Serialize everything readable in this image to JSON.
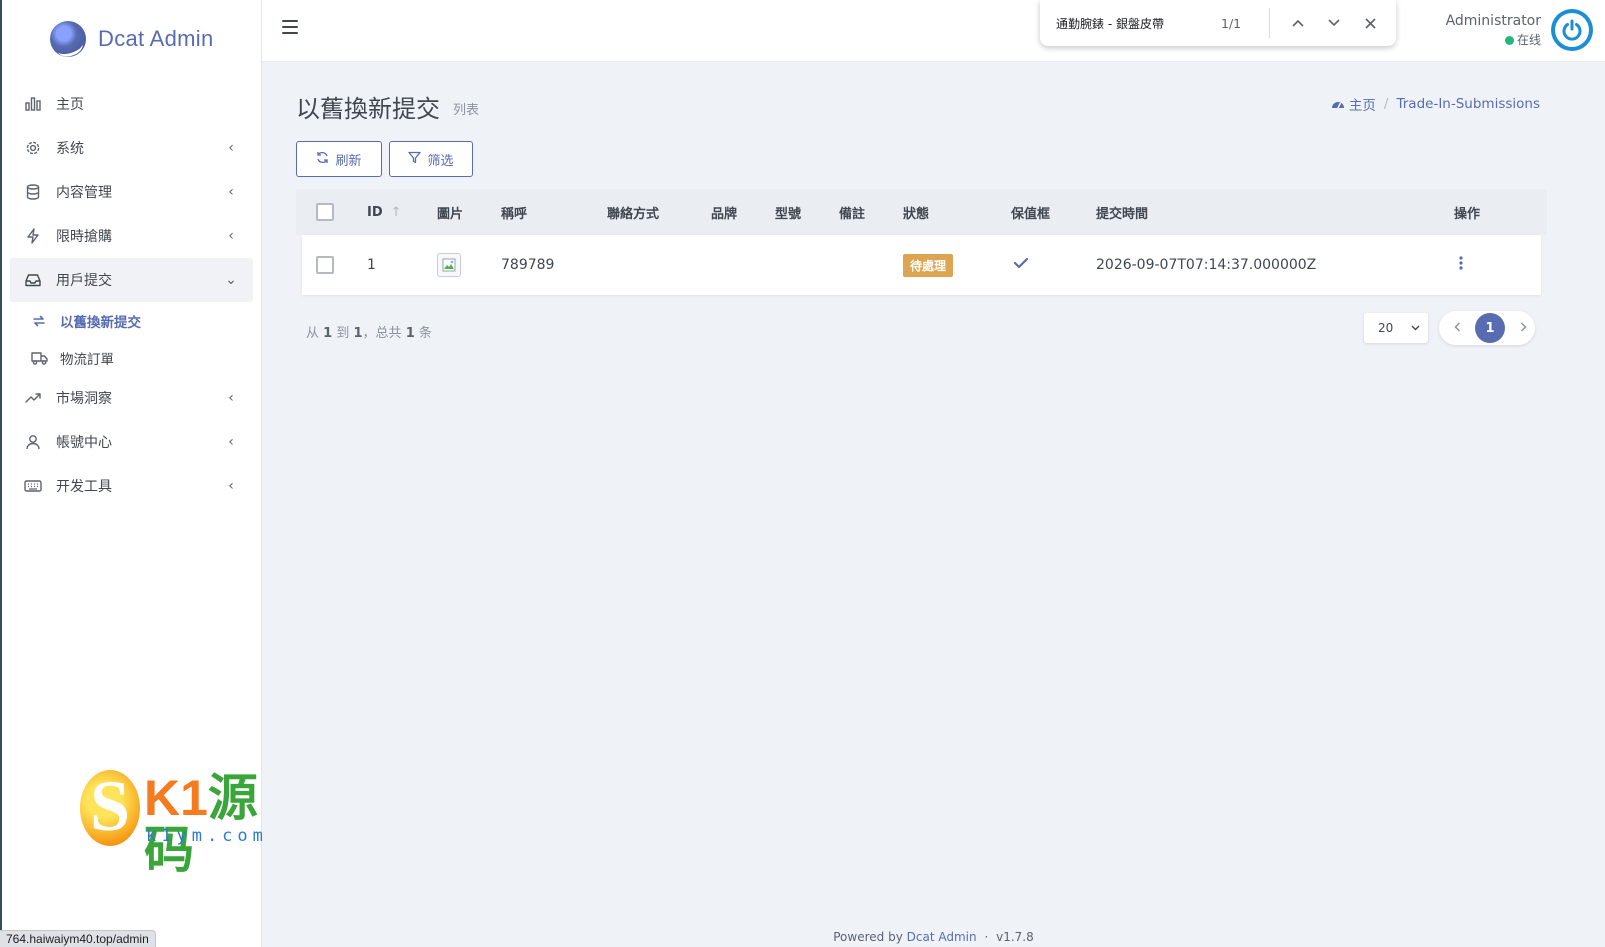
{
  "brand": {
    "name": "Dcat Admin"
  },
  "sidebar": {
    "items": [
      {
        "label": "主页",
        "icon": "bar-chart-icon",
        "arrow": ""
      },
      {
        "label": "系统",
        "icon": "gear-icon",
        "arrow": "‹"
      },
      {
        "label": "内容管理",
        "icon": "database-icon",
        "arrow": "‹"
      },
      {
        "label": "限時搶購",
        "icon": "lightning-icon",
        "arrow": "‹"
      },
      {
        "label": "用戶提交",
        "icon": "inbox-icon",
        "arrow": "⌄"
      },
      {
        "label": "市場洞察",
        "icon": "trend-icon",
        "arrow": "‹"
      },
      {
        "label": "帳號中心",
        "icon": "user-icon",
        "arrow": "‹"
      },
      {
        "label": "开发工具",
        "icon": "keyboard-icon",
        "arrow": "‹"
      }
    ],
    "subitems": [
      {
        "label": "以舊換新提交",
        "icon": "swap-icon"
      },
      {
        "label": "物流訂單",
        "icon": "truck-icon"
      }
    ]
  },
  "findbar": {
    "query": "通勤腕錶 - 銀盤皮帶",
    "count": "1/1"
  },
  "user": {
    "name": "Administrator",
    "status": "在线"
  },
  "page": {
    "title": "以舊換新提交",
    "subtitle": "列表",
    "breadcrumb": {
      "home": "主页",
      "current": "Trade-In-Submissions"
    }
  },
  "toolbar": {
    "refresh_label": "刷新",
    "filter_label": "筛选"
  },
  "table": {
    "columns": [
      "ID",
      "圖片",
      "稱呼",
      "聯絡方式",
      "品牌",
      "型號",
      "備註",
      "狀態",
      "保值框",
      "提交時間",
      "操作"
    ],
    "rows": [
      {
        "id": "1",
        "name": "789789",
        "contact": "",
        "brand": "",
        "model": "",
        "note": "",
        "status": "待處理",
        "valued": true,
        "submitted": "2026-09-07T07:14:37.000000Z"
      }
    ]
  },
  "pagination": {
    "summary_prefix": "从",
    "from": "1",
    "to_word": "到",
    "to": "1",
    "total_word": "，总共",
    "total": "1",
    "unit": "条",
    "per_page": "20",
    "current_page": "1"
  },
  "footer": {
    "prefix": "Powered by",
    "brand": "Dcat Admin",
    "sep": "·",
    "version": "v1.7.8"
  },
  "watermark": {
    "text_a": "K1",
    "text_b": "源码",
    "url": "k1ym.com"
  },
  "statusbar": {
    "url": "764.haiwaiym40.top/admin"
  },
  "colors": {
    "primary": "#586cb1",
    "badge_pending": "#dda451",
    "online": "#21b978"
  }
}
